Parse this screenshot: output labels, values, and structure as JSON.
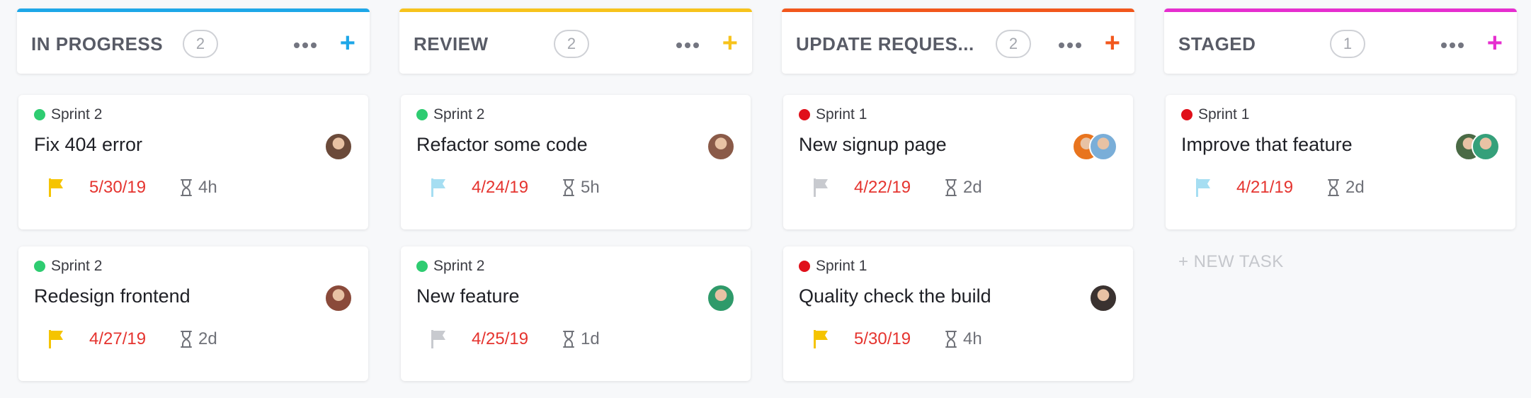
{
  "columns": [
    {
      "title": "IN PROGRESS",
      "count": "2",
      "accent": "#1ea7e8",
      "cards": [
        {
          "sprint": "Sprint 2",
          "sprint_color": "#2ecc71",
          "title": "Fix 404 error",
          "priority_flag": "#f5c400",
          "due_date": "5/30/19",
          "estimate": "4h",
          "avatars": [
            "#6b4a3a"
          ]
        },
        {
          "sprint": "Sprint 2",
          "sprint_color": "#2ecc71",
          "title": "Redesign frontend",
          "priority_flag": "#f5c400",
          "due_date": "4/27/19",
          "estimate": "2d",
          "avatars": [
            "#8a4a3a"
          ]
        }
      ]
    },
    {
      "title": "REVIEW",
      "count": "2",
      "accent": "#f7c31c",
      "cards": [
        {
          "sprint": "Sprint 2",
          "sprint_color": "#2ecc71",
          "title": "Refactor some code",
          "priority_flag": "#a6def2",
          "due_date": "4/24/19",
          "estimate": "5h",
          "avatars": [
            "#8a5a48"
          ]
        },
        {
          "sprint": "Sprint 2",
          "sprint_color": "#2ecc71",
          "title": "New feature",
          "priority_flag": "#c8cacf",
          "due_date": "4/25/19",
          "estimate": "1d",
          "avatars": [
            "#2f9a6a"
          ]
        }
      ]
    },
    {
      "title": "UPDATE REQUES...",
      "count": "2",
      "accent": "#f2571c",
      "cards": [
        {
          "sprint": "Sprint 1",
          "sprint_color": "#e0101a",
          "title": "New signup page",
          "priority_flag": "#c8cacf",
          "due_date": "4/22/19",
          "estimate": "2d",
          "avatars": [
            "#e8741e",
            "#7aaed8"
          ]
        },
        {
          "sprint": "Sprint 1",
          "sprint_color": "#e0101a",
          "title": "Quality check the build",
          "priority_flag": "#f5c400",
          "due_date": "5/30/19",
          "estimate": "4h",
          "avatars": [
            "#3a3230"
          ]
        }
      ]
    },
    {
      "title": "STAGED",
      "count": "1",
      "accent": "#e62ecf",
      "cards": [
        {
          "sprint": "Sprint 1",
          "sprint_color": "#e0101a",
          "title": "Improve that feature",
          "priority_flag": "#a6def2",
          "due_date": "4/21/19",
          "estimate": "2d",
          "avatars": [
            "#4a6a45",
            "#35a07a"
          ]
        }
      ],
      "new_task_label": "+ NEW TASK"
    }
  ]
}
